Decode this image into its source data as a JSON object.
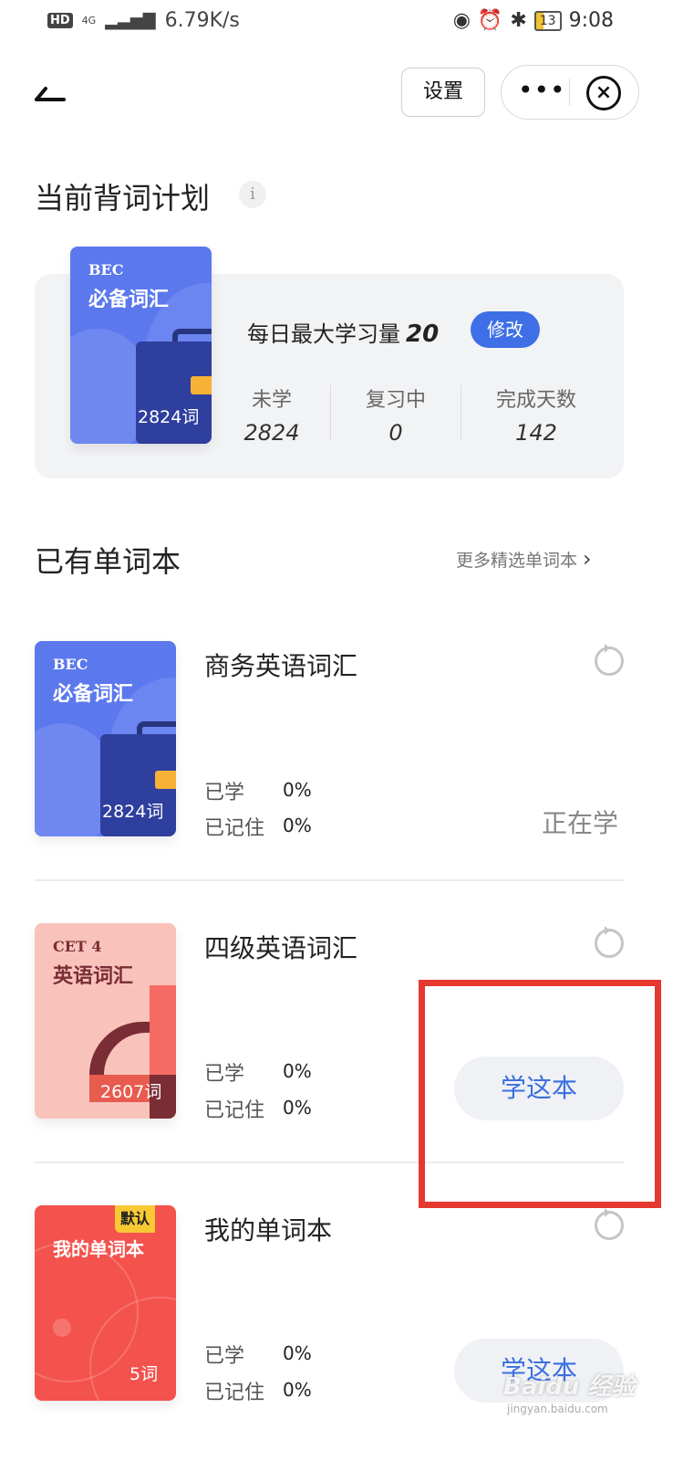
{
  "status_bar": {
    "hd": "HD",
    "network_type": "4G",
    "speed": "6.79K/s",
    "battery": "13",
    "time": "9:08",
    "icons": [
      "eye-icon",
      "alarm-icon",
      "bluetooth-icon",
      "battery-icon"
    ]
  },
  "header": {
    "back_icon": "back-arrow-icon",
    "settings_label": "设置",
    "more_label": "•••",
    "close_label": "×"
  },
  "plan": {
    "title": "当前背词计划",
    "info_label": "i",
    "cover": {
      "line1": "BEC",
      "line2": "必备词汇",
      "count": "2824词"
    },
    "daily_label": "每日最大学习量",
    "daily_value": "20",
    "edit_label": "修改",
    "stats": [
      {
        "label": "未学",
        "value": "2824"
      },
      {
        "label": "复习中",
        "value": "0"
      },
      {
        "label": "完成天数",
        "value": "142"
      }
    ]
  },
  "books_section": {
    "title": "已有单词本",
    "more_link": "更多精选单词本",
    "chevron": "›"
  },
  "books": [
    {
      "name": "商务英语词汇",
      "cover": {
        "line1": "BEC",
        "line2": "必备词汇",
        "count": "2824词"
      },
      "learned_label": "已学",
      "learned_value": "0%",
      "remembered_label": "已记住",
      "remembered_value": "0%",
      "action": "正在学"
    },
    {
      "name": "四级英语词汇",
      "cover": {
        "line1": "CET 4",
        "line2": "英语词汇",
        "count": "2607词"
      },
      "learned_label": "已学",
      "learned_value": "0%",
      "remembered_label": "已记住",
      "remembered_value": "0%",
      "action": "学这本"
    },
    {
      "name": "我的单词本",
      "cover": {
        "badge": "默认",
        "line1": "我的单词本",
        "count": "5词"
      },
      "learned_label": "已学",
      "learned_value": "0%",
      "remembered_label": "已记住",
      "remembered_value": "0%",
      "action": "学这本"
    }
  ],
  "watermark": {
    "text": "Baidu 经验",
    "sub": "jingyan.baidu.com"
  },
  "colors": {
    "accent": "#3e6fe6",
    "highlight": "#e5382f",
    "bec_cover": "#5b78ed",
    "cet_cover": "#f9c3bb",
    "my_cover": "#f4524d"
  }
}
